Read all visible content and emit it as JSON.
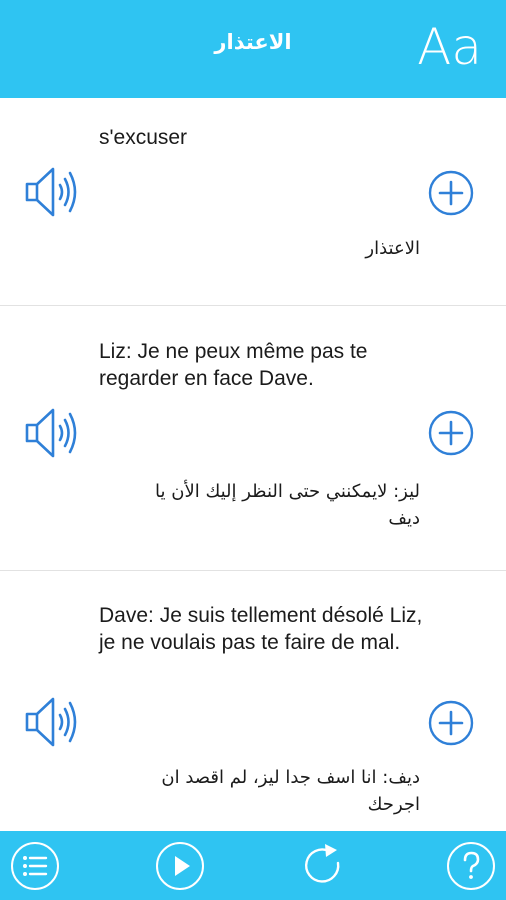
{
  "header": {
    "title": "الاعتذار",
    "font_button_label": "Aa"
  },
  "cards": [
    {
      "french": "s'excuser",
      "arabic": "الاعتذار"
    },
    {
      "french": "Liz: Je ne peux même pas te regarder en face Dave.",
      "arabic": "ليز: لايمكنني حتى النظر إليك الأن يا ديف"
    },
    {
      "french": "Dave: Je suis tellement désolé Liz, je ne voulais pas te faire de mal.",
      "arabic": "ديف: انا اسف جدا ليز، لم اقصد ان اجرحك"
    }
  ],
  "icons": {
    "speaker": "speaker-icon",
    "add": "plus-circle-icon",
    "list": "list-icon",
    "play": "play-icon",
    "repeat": "repeat-icon",
    "help": "help-icon"
  },
  "colors": {
    "accent": "#2fc4f2",
    "icon_blue": "#2f80d8",
    "text": "#1b1b1b"
  }
}
